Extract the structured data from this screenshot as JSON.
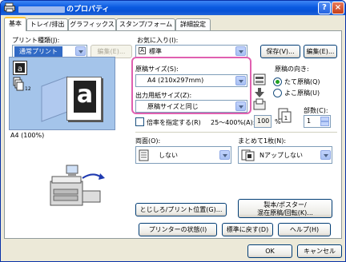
{
  "window": {
    "title_suffix": "のプロパティ",
    "help_label": "?",
    "close_label": "×"
  },
  "tabs": [
    {
      "label": "基本"
    },
    {
      "label": "トレイ/排出"
    },
    {
      "label": "グラフィックス"
    },
    {
      "label": "スタンプ/フォーム"
    },
    {
      "label": "詳細設定"
    }
  ],
  "print_type": {
    "label": "プリント種類(J):",
    "value": "通常プリント",
    "edit_button": "編集(E)..."
  },
  "favorites": {
    "label": "お気に入り(I):",
    "value": "標準",
    "save_button": "保存(V)...",
    "edit_button": "編集(E)..."
  },
  "preview": {
    "status": "A4 (100%)",
    "sheet_letter": "a"
  },
  "original_size": {
    "label": "原稿サイズ(S):",
    "value": "A4 (210x297mm)"
  },
  "output_size": {
    "label": "出力用紙サイズ(Z):",
    "value": "原稿サイズと同じ"
  },
  "orientation": {
    "label": "原稿の向き:",
    "options": [
      "たて原稿(Q)",
      "よこ原稿(U)"
    ],
    "selected": 0
  },
  "copies": {
    "label": "部数(C):",
    "value": "1"
  },
  "scale": {
    "label": "倍率を指定する(R)",
    "range": "25〜400%(A):",
    "value": "100",
    "unit": "%"
  },
  "duplex": {
    "label": "両面(O):",
    "value": "しない"
  },
  "nup": {
    "label": "まとめて1枚(N):",
    "value": "Nアップしない"
  },
  "buttons": {
    "binding": "とじしろ/プリント位置(G)...",
    "booklet_line1": "製本/ポスター/",
    "booklet_line2": "混在原稿/回転(K)...",
    "printer_status": "プリンターの状態(I)",
    "defaults": "標準に戻す(D)",
    "help": "ヘルプ(H)",
    "ok": "OK",
    "cancel": "キャンセル"
  },
  "colors": {
    "title_bar": "#0a5ae0",
    "highlight": "#e060b0",
    "selection": "#316ac5",
    "preview_bg": "#a4c4ea"
  }
}
